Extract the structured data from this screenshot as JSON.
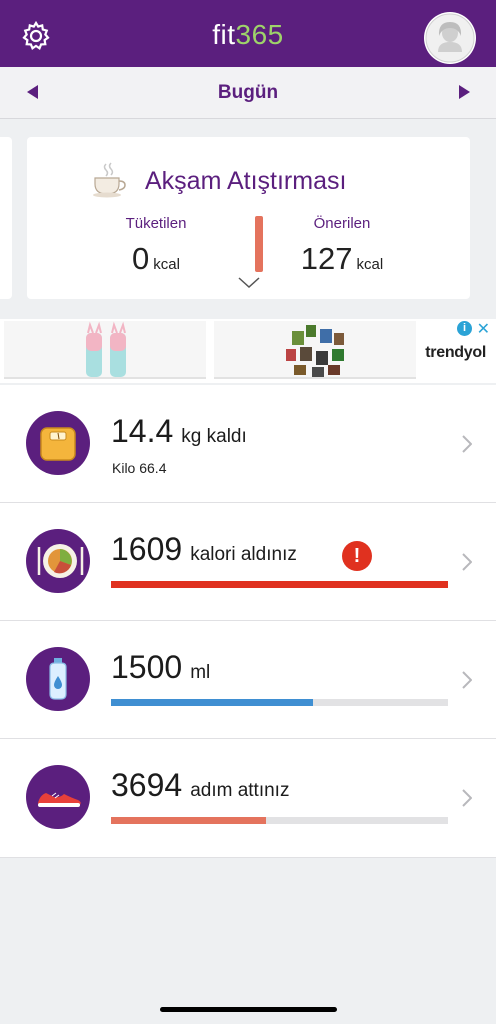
{
  "header": {
    "logo_fit": "fit",
    "logo_num": "365",
    "settings_icon": "gear-icon",
    "avatar_icon": "user-avatar-icon",
    "brand_color": "#5b1f7e",
    "accent_color": "#9ed36a"
  },
  "date_nav": {
    "label": "Bugün",
    "prev_icon": "triangle-left-icon",
    "next_icon": "triangle-right-icon"
  },
  "meal_card": {
    "title": "Akşam Atıştırması",
    "icon": "tea-cup-icon",
    "consumed_label": "Tüketilen",
    "consumed_value": "0",
    "consumed_unit": "kcal",
    "recommended_label": "Önerilen",
    "recommended_value": "127",
    "recommended_unit": "kcal",
    "expand_icon": "chevron-down-icon"
  },
  "ad": {
    "brand": "trendyol",
    "info_icon": "info-icon",
    "close_label": "✕"
  },
  "stats": [
    {
      "icon": "scale-icon",
      "value": "14.4",
      "suffix": "kg kaldı",
      "sub": "Kilo 66.4"
    },
    {
      "icon": "plate-icon",
      "value": "1609",
      "suffix": "kalori aldınız",
      "alert": "!",
      "progress": 1.0,
      "bar_color": "#e0311f"
    },
    {
      "icon": "water-bottle-icon",
      "value": "1500",
      "suffix": "ml",
      "progress": 0.6,
      "bar_color": "#3f8fd2"
    },
    {
      "icon": "sneaker-icon",
      "value": "3694",
      "suffix": "adım attınız",
      "progress": 0.46,
      "bar_color": "#e4735d"
    }
  ]
}
